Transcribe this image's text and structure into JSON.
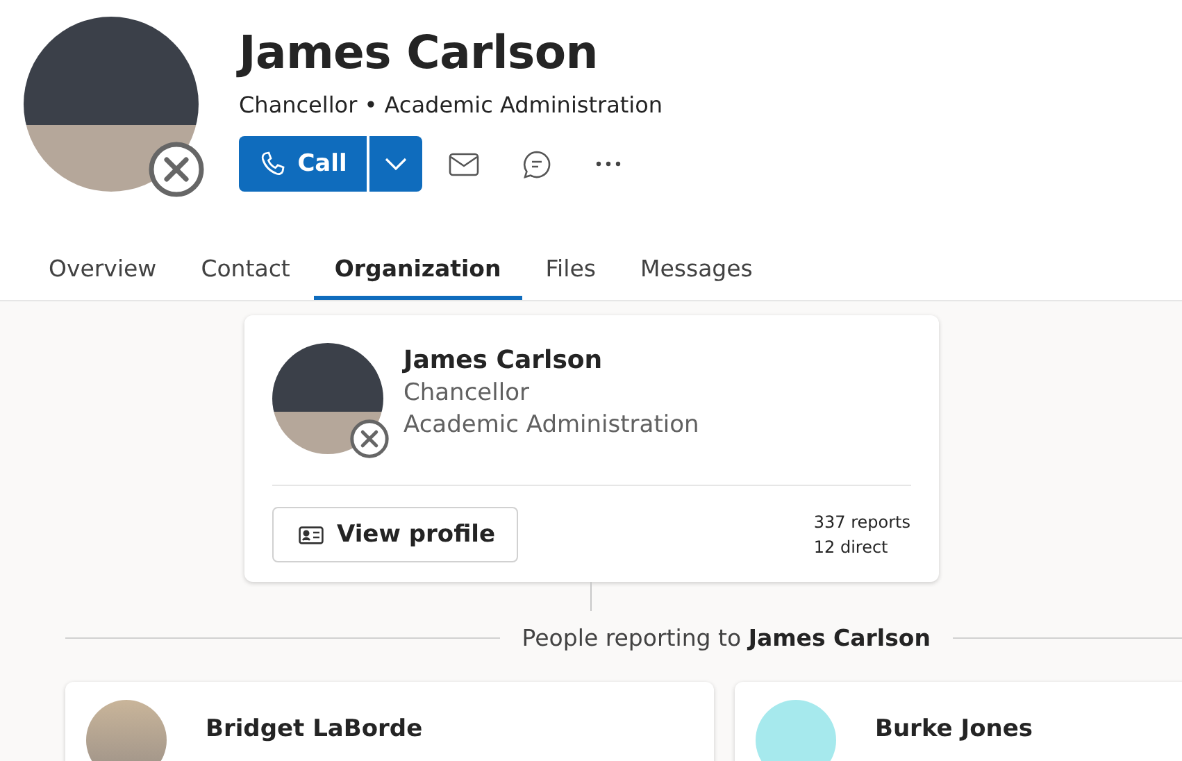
{
  "profile": {
    "name": "James Carlson",
    "subtitle": "Chancellor • Academic Administration",
    "call_label": "Call"
  },
  "tabs": [
    {
      "label": "Overview",
      "selected": false
    },
    {
      "label": "Contact",
      "selected": false
    },
    {
      "label": "Organization",
      "selected": true
    },
    {
      "label": "Files",
      "selected": false
    },
    {
      "label": "Messages",
      "selected": false
    }
  ],
  "manager": {
    "name": "James Carlson",
    "title": "Chancellor",
    "department": "Academic Administration",
    "button": "View profile",
    "reports": "337 reports",
    "direct": "12 direct"
  },
  "reporting_heading": "People reporting to **James Carlson**",
  "direct_reports": [
    {
      "name": "Bridget LaBorde",
      "kind": "photo"
    },
    {
      "name": "Burke Jones",
      "kind": "color",
      "color": "#a6e9ed"
    }
  ]
}
